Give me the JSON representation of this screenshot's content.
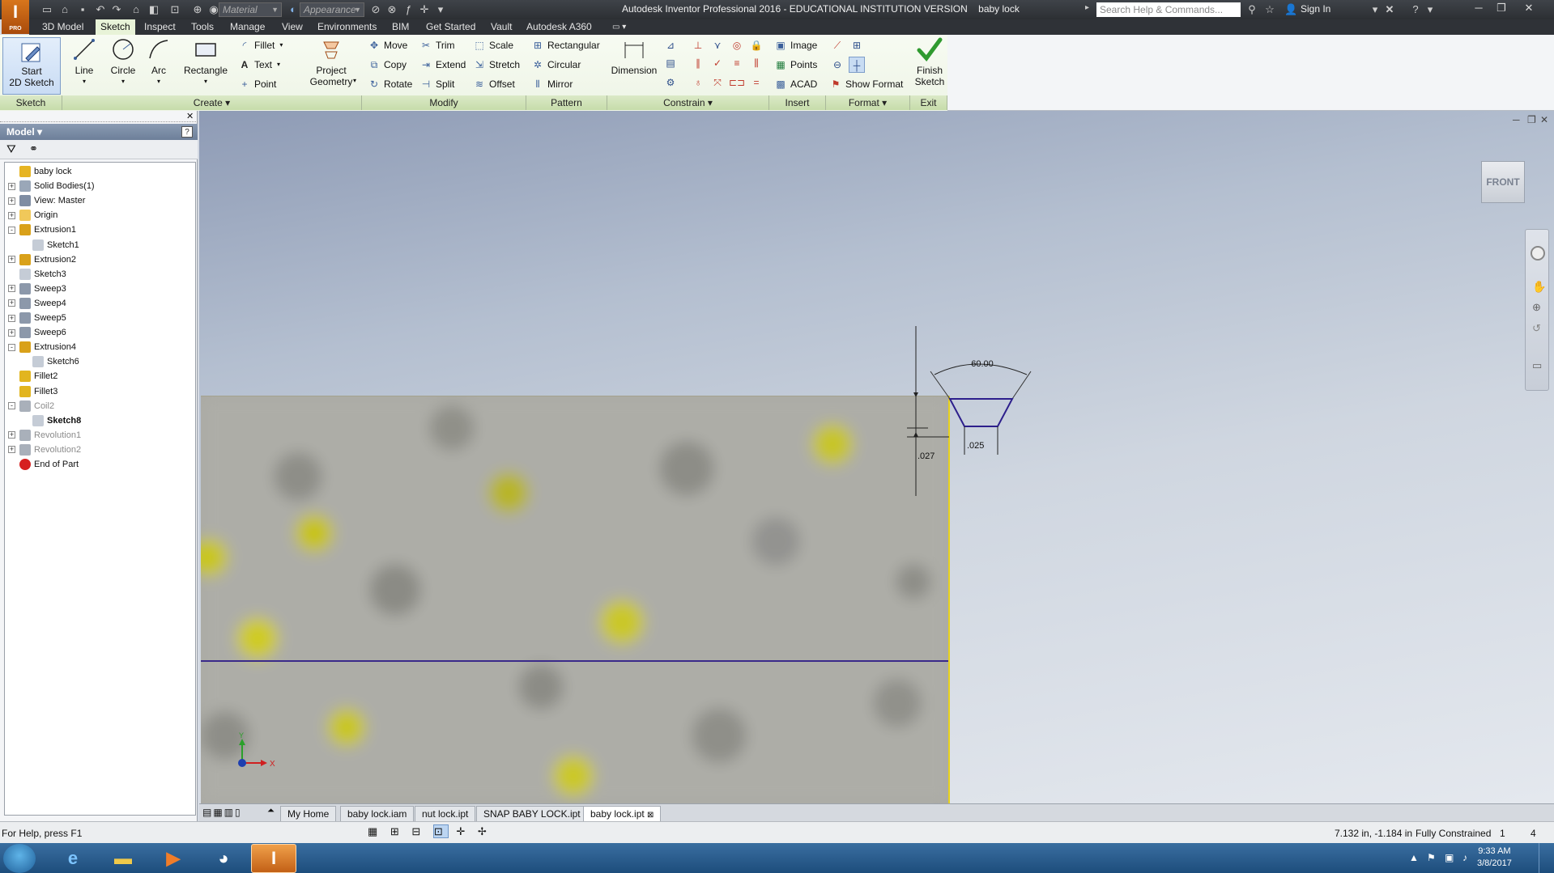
{
  "app": {
    "logo_text": "I",
    "logo_sub": "PRO",
    "window_title": "Autodesk Inventor Professional 2016 - EDUCATIONAL INSTITUTION VERSION",
    "document_name": "baby lock",
    "material_placeholder": "Material",
    "appearance_placeholder": "Appearance",
    "search_placeholder": "Search Help & Commands...",
    "sign_in": "Sign In"
  },
  "ribbon_tabs": [
    "3D Model",
    "Sketch",
    "Inspect",
    "Tools",
    "Manage",
    "View",
    "Environments",
    "BIM",
    "Get Started",
    "Vault",
    "Autodesk A360"
  ],
  "ribbon": {
    "sketch_panel": {
      "title": "Sketch",
      "start_2d": "Start\n2D Sketch"
    },
    "create_panel": {
      "title": "Create",
      "line": "Line",
      "circle": "Circle",
      "arc": "Arc",
      "rectangle": "Rectangle",
      "fillet": "Fillet",
      "text": "Text",
      "point": "Point",
      "project_geometry": "Project\nGeometry"
    },
    "modify_panel": {
      "title": "Modify",
      "move": "Move",
      "trim": "Trim",
      "scale": "Scale",
      "copy": "Copy",
      "extend": "Extend",
      "stretch": "Stretch",
      "rotate": "Rotate",
      "split": "Split",
      "offset": "Offset"
    },
    "pattern_panel": {
      "title": "Pattern",
      "rectangular": "Rectangular",
      "circular": "Circular",
      "mirror": "Mirror"
    },
    "constrain_panel": {
      "title": "Constrain",
      "dimension": "Dimension"
    },
    "insert_panel": {
      "title": "Insert",
      "image": "Image",
      "points": "Points",
      "acad": "ACAD"
    },
    "format_panel": {
      "title": "Format",
      "show_format": "Show Format"
    },
    "exit_panel": {
      "title": "Exit",
      "finish_sketch": "Finish\nSketch"
    }
  },
  "browser": {
    "title": "Model",
    "tree": [
      {
        "label": "baby lock",
        "level": 0,
        "expand": "none",
        "icon": "part-icon",
        "state": "normal"
      },
      {
        "label": "Solid Bodies(1)",
        "level": 0,
        "expand": "+",
        "icon": "solid-bodies-icon",
        "state": "normal"
      },
      {
        "label": "View: Master",
        "level": 0,
        "expand": "+",
        "icon": "view-icon",
        "state": "normal"
      },
      {
        "label": "Origin",
        "level": 0,
        "expand": "+",
        "icon": "folder-icon",
        "state": "normal"
      },
      {
        "label": "Extrusion1",
        "level": 0,
        "expand": "-",
        "icon": "extrusion-icon",
        "state": "normal"
      },
      {
        "label": "Sketch1",
        "level": 1,
        "expand": "none",
        "icon": "sketch-icon",
        "state": "normal"
      },
      {
        "label": "Extrusion2",
        "level": 0,
        "expand": "+",
        "icon": "extrusion-icon",
        "state": "normal"
      },
      {
        "label": "Sketch3",
        "level": 0,
        "expand": "none",
        "icon": "sketch-icon",
        "state": "normal"
      },
      {
        "label": "Sweep3",
        "level": 0,
        "expand": "+",
        "icon": "sweep-icon",
        "state": "normal"
      },
      {
        "label": "Sweep4",
        "level": 0,
        "expand": "+",
        "icon": "sweep-icon",
        "state": "normal"
      },
      {
        "label": "Sweep5",
        "level": 0,
        "expand": "+",
        "icon": "sweep-icon",
        "state": "normal"
      },
      {
        "label": "Sweep6",
        "level": 0,
        "expand": "+",
        "icon": "sweep-icon",
        "state": "normal"
      },
      {
        "label": "Extrusion4",
        "level": 0,
        "expand": "-",
        "icon": "extrusion-icon",
        "state": "normal"
      },
      {
        "label": "Sketch6",
        "level": 1,
        "expand": "none",
        "icon": "sketch-icon",
        "state": "normal"
      },
      {
        "label": "Fillet2",
        "level": 0,
        "expand": "none",
        "icon": "fillet-icon",
        "state": "normal"
      },
      {
        "label": "Fillet3",
        "level": 0,
        "expand": "none",
        "icon": "fillet-icon",
        "state": "normal"
      },
      {
        "label": "Coil2",
        "level": 0,
        "expand": "-",
        "icon": "coil-icon",
        "state": "dim"
      },
      {
        "label": "Sketch8",
        "level": 1,
        "expand": "none",
        "icon": "sketch-icon",
        "state": "active"
      },
      {
        "label": "Revolution1",
        "level": 0,
        "expand": "+",
        "icon": "revolution-icon",
        "state": "dim"
      },
      {
        "label": "Revolution2",
        "level": 0,
        "expand": "+",
        "icon": "revolution-icon",
        "state": "dim"
      },
      {
        "label": "End of Part",
        "level": 0,
        "expand": "none",
        "icon": "end-of-part-icon",
        "state": "normal"
      }
    ]
  },
  "viewport": {
    "viewcube_label": "FRONT",
    "dim_angle": "60.00",
    "dim_height": ".027",
    "dim_width": ".025",
    "axis_x": "X",
    "axis_y": "Y",
    "colors": {
      "sketch_line": "#3a2a8a",
      "edge_highlight": "#e8d21a",
      "face": "#a9a9a3"
    }
  },
  "doc_tabs": [
    "My Home",
    "baby lock.iam",
    "nut lock.ipt",
    "SNAP BABY LOCK.ipt",
    "baby lock.ipt"
  ],
  "active_doc_tab": "baby lock.ipt",
  "status": {
    "help": "For Help, press F1",
    "coords": "7.132 in, -1.184 in",
    "constraint_state": "Fully Constrained",
    "count1": "1",
    "count2": "4"
  },
  "taskbar": {
    "time": "9:33 AM",
    "date": "3/8/2017"
  }
}
